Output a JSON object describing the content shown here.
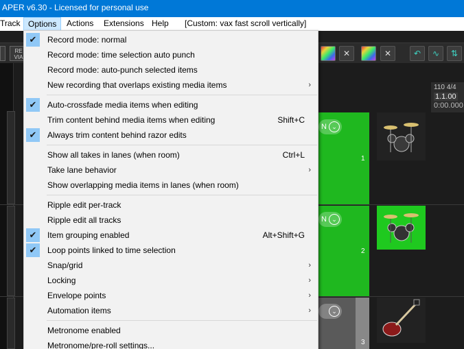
{
  "window": {
    "title": "APER v6.30 - Licensed for personal use"
  },
  "menubar": {
    "items": [
      {
        "label": "Track"
      },
      {
        "label": "Options"
      },
      {
        "label": "Actions"
      },
      {
        "label": "Extensions"
      },
      {
        "label": "Help"
      },
      {
        "label": "[Custom: vax fast scroll vertically]"
      }
    ]
  },
  "toolbar": {
    "left_button_label": "RE VIA"
  },
  "ruler": {
    "tempo": "110 4/4",
    "bars": "1.1.00",
    "time": "0:00.000"
  },
  "tracks": [
    {
      "number": "1",
      "item_label": "N"
    },
    {
      "number": "2",
      "item_label": "N"
    },
    {
      "number": "3"
    }
  ],
  "options_menu": {
    "items": [
      {
        "label": "Record mode: normal",
        "checked": true,
        "shortcut": "",
        "submenu": false
      },
      {
        "label": "Record mode: time selection auto punch",
        "checked": false,
        "shortcut": "",
        "submenu": false
      },
      {
        "label": "Record mode: auto-punch selected items",
        "checked": false,
        "shortcut": "",
        "submenu": false
      },
      {
        "label": "New recording that overlaps existing media items",
        "checked": false,
        "shortcut": "",
        "submenu": true
      },
      {
        "label": "Auto-crossfade media items when editing",
        "checked": true,
        "shortcut": "",
        "submenu": false
      },
      {
        "label": "Trim content behind media items when editing",
        "checked": false,
        "shortcut": "Shift+C",
        "submenu": false
      },
      {
        "label": "Always trim content behind razor edits",
        "checked": true,
        "shortcut": "",
        "submenu": false
      },
      {
        "label": "Show all takes in lanes (when room)",
        "checked": false,
        "shortcut": "Ctrl+L",
        "submenu": false
      },
      {
        "label": "Take lane behavior",
        "checked": false,
        "shortcut": "",
        "submenu": true
      },
      {
        "label": "Show overlapping media items in lanes (when room)",
        "checked": false,
        "shortcut": "",
        "submenu": false
      },
      {
        "label": "Ripple edit per-track",
        "checked": false,
        "shortcut": "",
        "submenu": false
      },
      {
        "label": "Ripple edit all tracks",
        "checked": false,
        "shortcut": "",
        "submenu": false
      },
      {
        "label": "Item grouping enabled",
        "checked": true,
        "shortcut": "Alt+Shift+G",
        "submenu": false
      },
      {
        "label": "Loop points linked to time selection",
        "checked": true,
        "shortcut": "",
        "submenu": false
      },
      {
        "label": "Snap/grid",
        "checked": false,
        "shortcut": "",
        "submenu": true
      },
      {
        "label": "Locking",
        "checked": false,
        "shortcut": "",
        "submenu": true
      },
      {
        "label": "Envelope points",
        "checked": false,
        "shortcut": "",
        "submenu": true
      },
      {
        "label": "Automation items",
        "checked": false,
        "shortcut": "",
        "submenu": true
      },
      {
        "label": "Metronome enabled",
        "checked": false,
        "shortcut": "",
        "submenu": false
      },
      {
        "label": "Metronome/pre-roll settings...",
        "checked": false,
        "shortcut": "",
        "submenu": false
      }
    ]
  },
  "icons": {
    "check": "✔",
    "submenu_arrow": "›",
    "item_chevron": "⌄",
    "close": "✕"
  }
}
